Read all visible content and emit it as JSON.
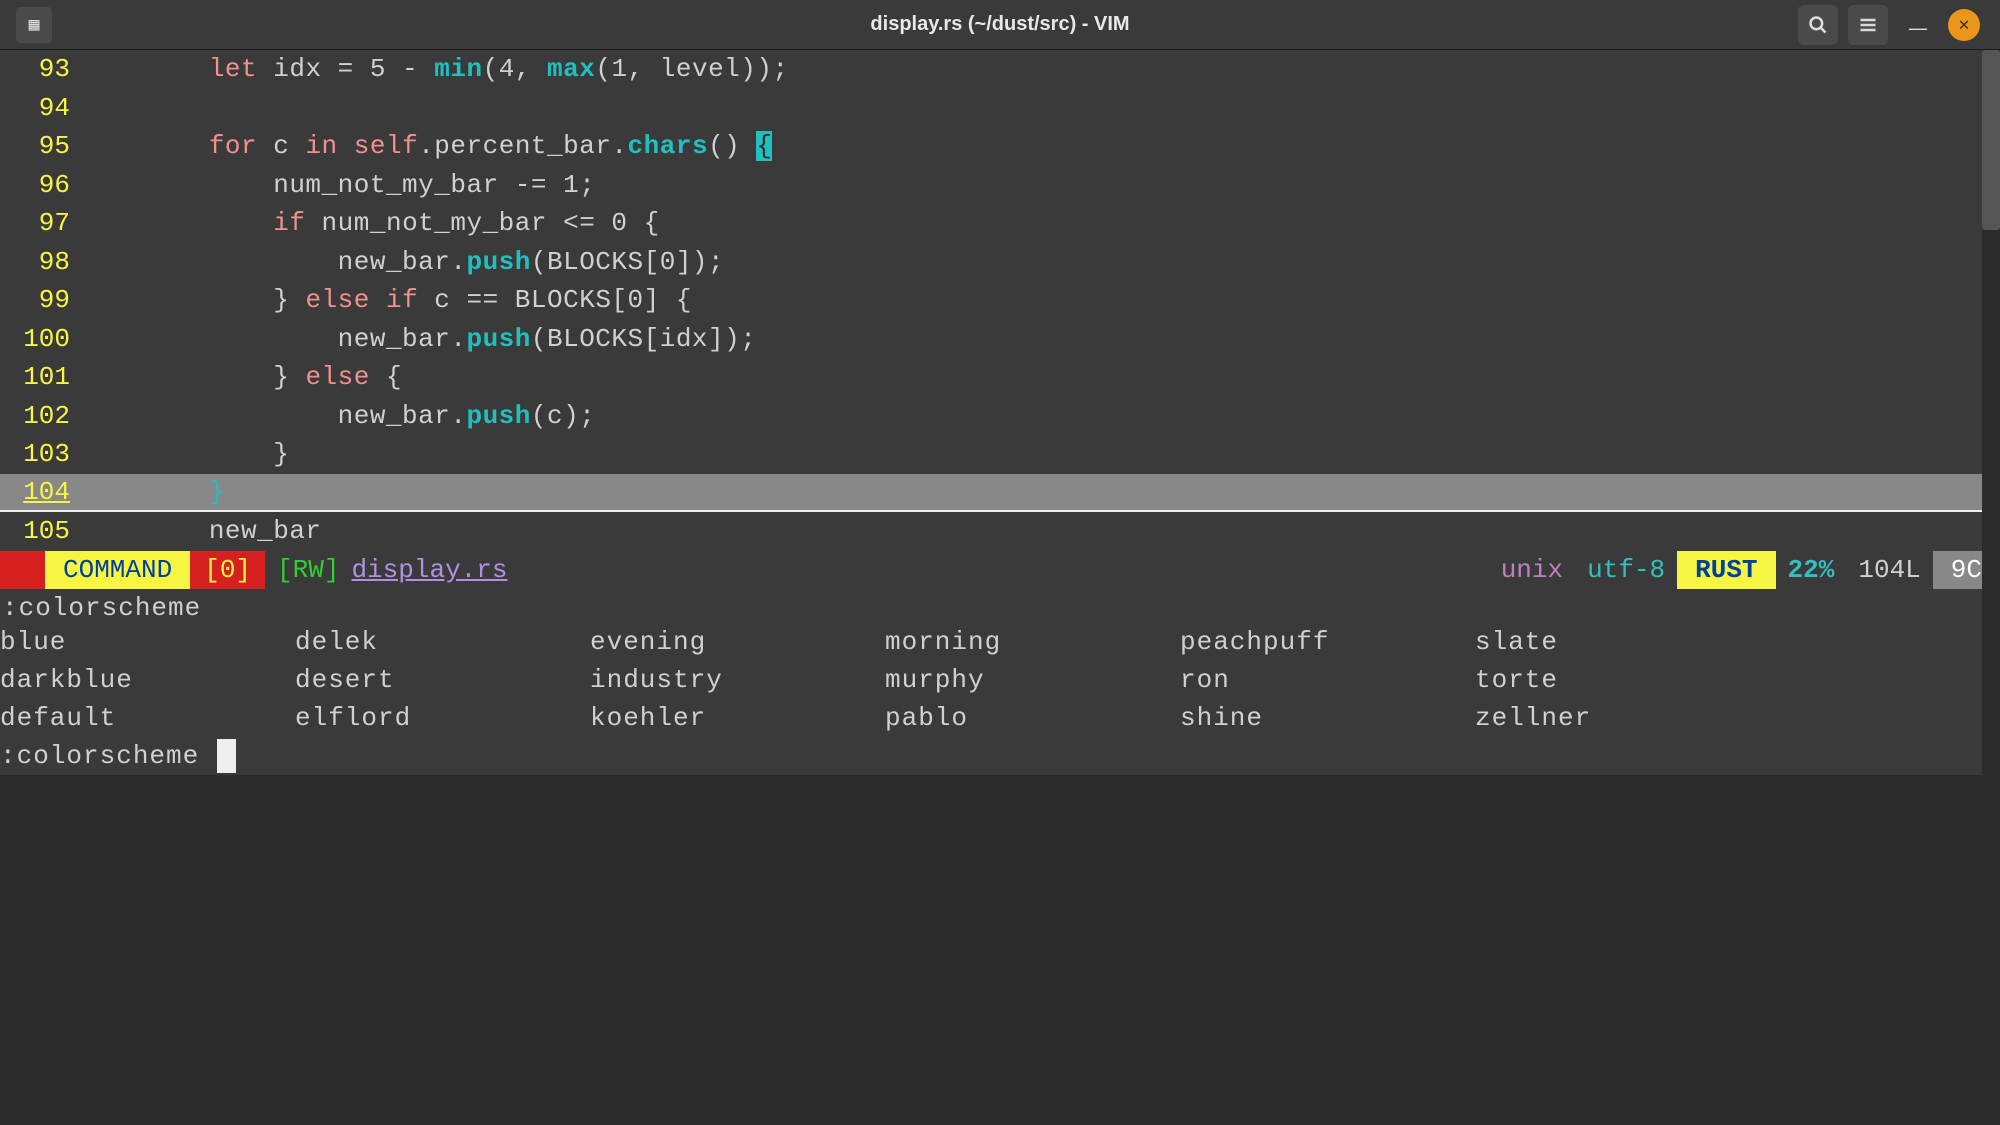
{
  "window": {
    "title": "display.rs (~/dust/src) - VIM"
  },
  "code": {
    "lines": [
      {
        "num": "93",
        "tokens": [
          {
            "t": "        ",
            "c": ""
          },
          {
            "t": "let",
            "c": "kw"
          },
          {
            "t": " idx = ",
            "c": ""
          },
          {
            "t": "5",
            "c": "num"
          },
          {
            "t": " - ",
            "c": ""
          },
          {
            "t": "min",
            "c": "fn"
          },
          {
            "t": "(",
            "c": ""
          },
          {
            "t": "4",
            "c": "num"
          },
          {
            "t": ", ",
            "c": ""
          },
          {
            "t": "max",
            "c": "fn"
          },
          {
            "t": "(",
            "c": ""
          },
          {
            "t": "1",
            "c": "num"
          },
          {
            "t": ", level));",
            "c": ""
          }
        ]
      },
      {
        "num": "94",
        "tokens": [
          {
            "t": "",
            "c": ""
          }
        ]
      },
      {
        "num": "95",
        "tokens": [
          {
            "t": "        ",
            "c": ""
          },
          {
            "t": "for",
            "c": "kw"
          },
          {
            "t": " c ",
            "c": ""
          },
          {
            "t": "in",
            "c": "kw"
          },
          {
            "t": " ",
            "c": ""
          },
          {
            "t": "self",
            "c": "kw"
          },
          {
            "t": ".percent_bar.",
            "c": ""
          },
          {
            "t": "chars",
            "c": "fn"
          },
          {
            "t": "() ",
            "c": ""
          },
          {
            "t": "{",
            "c": "hl-bracket"
          }
        ]
      },
      {
        "num": "96",
        "tokens": [
          {
            "t": "            num_not_my_bar -= ",
            "c": ""
          },
          {
            "t": "1",
            "c": "num"
          },
          {
            "t": ";",
            "c": ""
          }
        ]
      },
      {
        "num": "97",
        "tokens": [
          {
            "t": "            ",
            "c": ""
          },
          {
            "t": "if",
            "c": "kw"
          },
          {
            "t": " num_not_my_bar <= ",
            "c": ""
          },
          {
            "t": "0",
            "c": "num"
          },
          {
            "t": " {",
            "c": ""
          }
        ]
      },
      {
        "num": "98",
        "tokens": [
          {
            "t": "                new_bar.",
            "c": ""
          },
          {
            "t": "push",
            "c": "fn"
          },
          {
            "t": "(BLOCKS[",
            "c": ""
          },
          {
            "t": "0",
            "c": "num"
          },
          {
            "t": "]);",
            "c": ""
          }
        ]
      },
      {
        "num": "99",
        "tokens": [
          {
            "t": "            } ",
            "c": ""
          },
          {
            "t": "else",
            "c": "kw"
          },
          {
            "t": " ",
            "c": ""
          },
          {
            "t": "if",
            "c": "kw"
          },
          {
            "t": " c == BLOCKS[",
            "c": ""
          },
          {
            "t": "0",
            "c": "num"
          },
          {
            "t": "] {",
            "c": ""
          }
        ]
      },
      {
        "num": "100",
        "tokens": [
          {
            "t": "                new_bar.",
            "c": ""
          },
          {
            "t": "push",
            "c": "fn"
          },
          {
            "t": "(BLOCKS[idx]);",
            "c": ""
          }
        ]
      },
      {
        "num": "101",
        "tokens": [
          {
            "t": "            } ",
            "c": ""
          },
          {
            "t": "else",
            "c": "kw"
          },
          {
            "t": " {",
            "c": ""
          }
        ]
      },
      {
        "num": "102",
        "tokens": [
          {
            "t": "                new_bar.",
            "c": ""
          },
          {
            "t": "push",
            "c": "fn"
          },
          {
            "t": "(c);",
            "c": ""
          }
        ]
      },
      {
        "num": "103",
        "tokens": [
          {
            "t": "            }",
            "c": ""
          }
        ]
      },
      {
        "num": "104",
        "current": true,
        "tokens": [
          {
            "t": "        ",
            "c": ""
          },
          {
            "t": "}",
            "c": "cursor-line-bracket"
          }
        ]
      },
      {
        "num": "105",
        "tokens": [
          {
            "t": "        new_bar",
            "c": ""
          }
        ]
      }
    ]
  },
  "status": {
    "mode": " COMMAND ",
    "zero": "[0]",
    "rw": "[RW]",
    "file": "display.rs",
    "unix": "unix",
    "enc": "utf-8",
    "lang": " RUST ",
    "pct": "22%",
    "lines": "104L",
    "col": " 9C "
  },
  "command": {
    "label": ":colorscheme",
    "columns": [
      [
        "blue",
        "darkblue",
        "default"
      ],
      [
        "delek",
        "desert",
        "elflord"
      ],
      [
        "evening",
        "industry",
        "koehler"
      ],
      [
        "morning",
        "murphy",
        "pablo"
      ],
      [
        "peachpuff",
        "ron",
        "shine"
      ],
      [
        "slate",
        "torte",
        "zellner"
      ]
    ],
    "input": ":colorscheme "
  }
}
